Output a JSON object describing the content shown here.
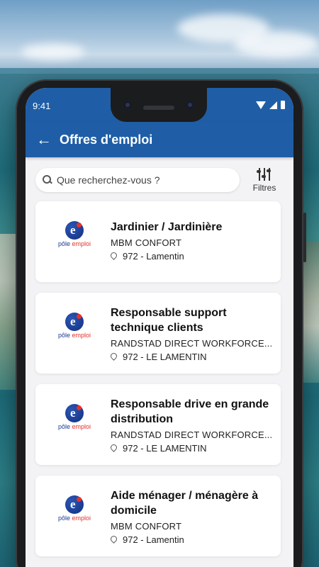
{
  "status": {
    "time": "9:41"
  },
  "appbar": {
    "title": "Offres d'emploi"
  },
  "search": {
    "placeholder": "Que recherchez-vous ?"
  },
  "filters": {
    "label": "Filtres"
  },
  "logo": {
    "part1": "pôle",
    "part2": " emploi"
  },
  "jobs": [
    {
      "title": "Jardinier / Jardinière",
      "company": "MBM CONFORT",
      "location": "972 - Lamentin"
    },
    {
      "title": "Responsable support technique clients",
      "company": "RANDSTAD DIRECT WORKFORCE...",
      "location": "972 - LE LAMENTIN"
    },
    {
      "title": "Responsable drive en grande distribution",
      "company": "RANDSTAD DIRECT WORKFORCE...",
      "location": "972 - LE LAMENTIN"
    },
    {
      "title": "Aide ménager / ménagère à domicile",
      "company": "MBM CONFORT",
      "location": "972 - Lamentin"
    }
  ],
  "colors": {
    "primary": "#1f5ea6",
    "logo_blue": "#1a3a8f",
    "logo_red": "#e2332e"
  },
  "icons": [
    "arrow-left-icon",
    "search-icon",
    "sliders-icon",
    "location-pin-icon",
    "wifi-icon",
    "signal-icon",
    "battery-icon"
  ]
}
